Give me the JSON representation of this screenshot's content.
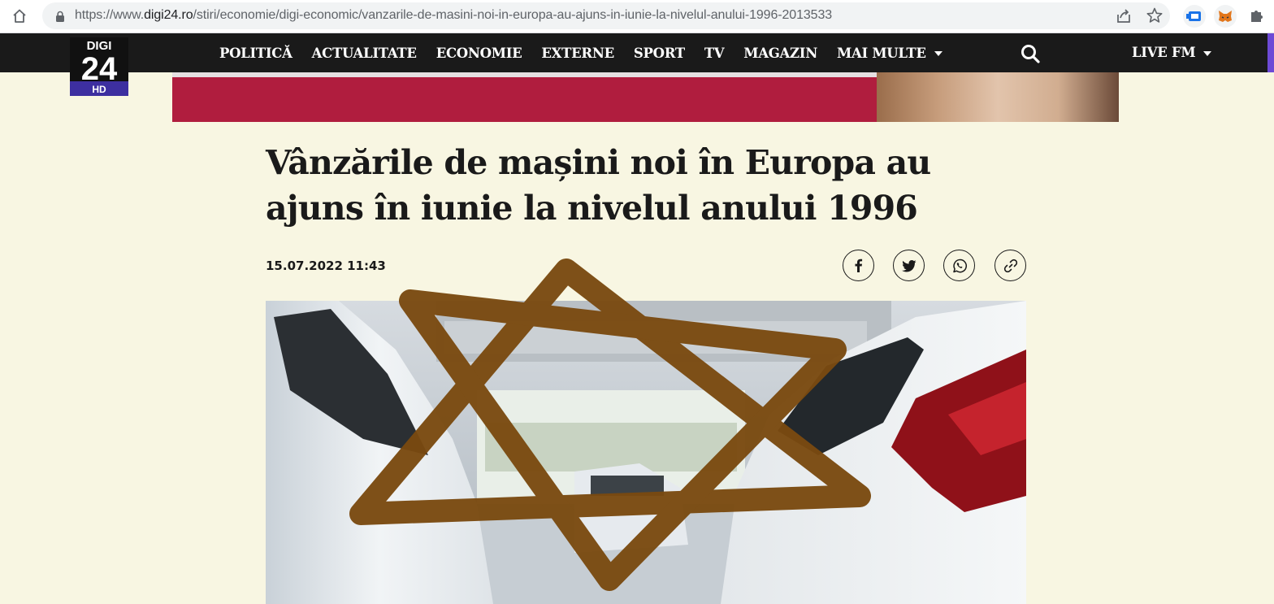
{
  "browser": {
    "url_host_prefix": "https://www.",
    "url_host": "digi24.ro",
    "url_path": "/stiri/economie/digi-economic/vanzarile-de-masini-noi-in-europa-au-ajuns-in-iunie-la-nivelul-anului-1996-2013533",
    "icons": [
      "home-icon",
      "lock-icon",
      "share-icon",
      "star-icon",
      "extension-icon",
      "metamask-icon",
      "puzzle-icon"
    ]
  },
  "logo": {
    "top": "DIGI",
    "number": "24",
    "badge": "HD"
  },
  "nav": {
    "items": [
      "POLITICĂ",
      "ACTUALITATE",
      "ECONOMIE",
      "EXTERNE",
      "SPORT",
      "TV",
      "MAGAZIN"
    ],
    "more_label": "MAI MULTE",
    "live_label": "LIVE FM"
  },
  "article": {
    "headline": "Vânzările de mașini noi în Europa au ajuns în iunie la nivelul anului 1996",
    "date": "15.07.2022 11:43",
    "share_icons": [
      "facebook-icon",
      "twitter-icon",
      "whatsapp-icon",
      "link-icon"
    ]
  },
  "colors": {
    "page_bg": "#f8f6e2",
    "nav_bg": "#1a1a1a",
    "banner_red": "#b01d3e",
    "logo_badge": "#3d2fa0",
    "overlay_stroke": "#7a4a10"
  }
}
